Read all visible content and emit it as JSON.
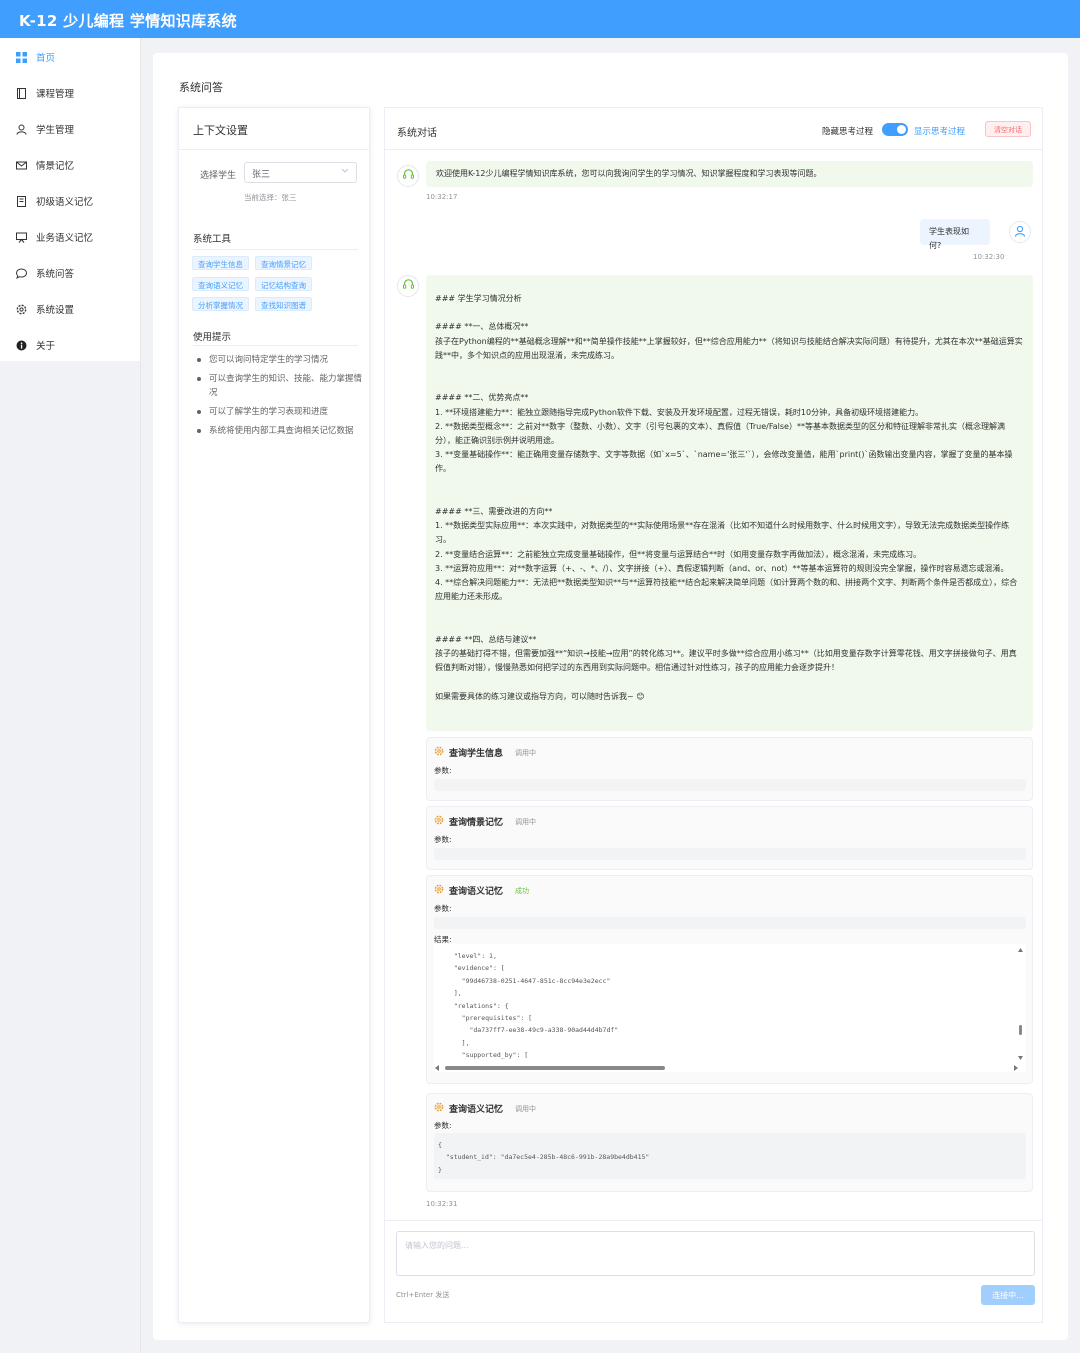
{
  "app": {
    "title": "K-12 少儿编程 学情知识库系统"
  },
  "sidebar": {
    "items": [
      {
        "label": "首页",
        "icon": "grid-icon",
        "active": true
      },
      {
        "label": "课程管理",
        "icon": "book-icon"
      },
      {
        "label": "学生管理",
        "icon": "user-icon"
      },
      {
        "label": "情景记忆",
        "icon": "mail-icon"
      },
      {
        "label": "初级语义记忆",
        "icon": "notebook-icon"
      },
      {
        "label": "业务语义记忆",
        "icon": "presentation-icon"
      },
      {
        "label": "系统问答",
        "icon": "chat-icon"
      },
      {
        "label": "系统设置",
        "icon": "gear-icon"
      },
      {
        "label": "关于",
        "icon": "info-icon"
      }
    ]
  },
  "page": {
    "title": "系统问答"
  },
  "context": {
    "title": "上下文设置",
    "select_label": "选择学生",
    "selected_student": "张三",
    "current_selection": "当前选择：张三",
    "tools_title": "系统工具",
    "tools": [
      "查询学生信息",
      "查询情景记忆",
      "查询语义记忆",
      "记忆结构查询",
      "分析掌握情况",
      "查找知识图谱"
    ],
    "tips_title": "使用提示",
    "tips": [
      "您可以询问特定学生的学习情况",
      "可以查询学生的知识、技能、能力掌握情况",
      "可以了解学生的学习表现和进度",
      "系统将使用内部工具查询相关记忆数据"
    ]
  },
  "chat": {
    "title": "系统对话",
    "hide_thinking": "隐藏思考过程",
    "show_thinking": "显示思考过程",
    "clear": "清空对话",
    "welcome": "欢迎使用K-12少儿编程学情知识库系统，您可以向我询问学生的学习情况、知识掌握程度和学习表现等问题。",
    "welcome_time": "10:32:17",
    "user_msg": "学生表现如何?",
    "user_time": "10:32:30",
    "answer": "### 学生学习情况分析\n\n#### **一、总体概况**\n孩子在Python编程的**基础概念理解**和**简单操作技能**上掌握较好，但**综合应用能力**（将知识与技能结合解决实际问题）有待提升，尤其在本次**基础运算实践**中，多个知识点的应用出现混淆，未完成练习。\n\n\n#### **二、优势亮点**\n1. **环境搭建能力**：能独立跟随指导完成Python软件下载、安装及开发环境配置，过程无错误，耗时10分钟，具备初级环境搭建能力。\n2. **数据类型概念**：之前对**数字（整数、小数）、文字（引号包裹的文本）、真假值（True/False）**等基本数据类型的区分和特征理解非常扎实（概念理解满分），能正确识别示例并说明用途。\n3. **变量基础操作**：能正确用变量存储数字、文字等数据（如`x=5`、`name='张三'`），会修改变量值，能用`print()`函数输出变量内容，掌握了变量的基本操作。\n\n\n#### **三、需要改进的方向**\n1. **数据类型实际应用**：本次实践中，对数据类型的**实际使用场景**存在混淆（比如不知道什么时候用数字、什么时候用文字），导致无法完成数据类型操作练习。\n2. **变量结合运算**：之前能独立完成变量基础操作，但**将变量与运算结合**时（如用变量存数字再做加法），概念混淆，未完成练习。\n3. **运算符应用**：对**数字运算（+、-、*、/）、文字拼接（+）、真假逻辑判断（and、or、not）**等基本运算符的规则没完全掌握，操作时容易遗忘或混淆。\n4. **综合解决问题能力**：无法把**数据类型知识**与**运算符技能**结合起来解决简单问题（如计算两个数的和、拼接两个文字、判断两个条件是否都成立），综合应用能力还未形成。\n\n\n#### **四、总结与建议**\n孩子的基础打得不错，但需要加强**“知识→技能→应用”的转化练习**。建议平时多做**综合应用小练习**（比如用变量存数字计算零花钱、用文字拼接做句子、用真假值判断对错），慢慢熟悉如何把学过的东西用到实际问题中。相信通过针对性练习，孩子的应用能力会逐步提升！\n\n如果需要具体的练习建议或指导方向，可以随时告诉我~ 😊",
    "params_label": "参数:",
    "result_label": "结果:",
    "tool_calls": [
      {
        "name": "查询学生信息",
        "status": "调用中"
      },
      {
        "name": "查询情景记忆",
        "status": "调用中"
      },
      {
        "name": "查询语义记忆",
        "status": "成功",
        "result": "  \"level\": 1,\n  \"evidence\": [\n    \"99d46738-0251-4647-851c-8cc94e3e2ecc\"\n  ],\n  \"relations\": {\n    \"prerequisites\": [\n      \"da737ff7-ee38-49c9-a338-90ad44d4b7df\"\n    ],\n    \"supported_by\": ["
      },
      {
        "name": "查询语义记忆",
        "status": "调用中",
        "params": "{\n  \"student_id\": \"da7ec5e4-285b-48c6-991b-28a9be4db415\"\n}"
      }
    ],
    "tools_time": "10:32:31",
    "input_placeholder": "请输入您的问题...",
    "hint": "Ctrl+Enter 发送",
    "send": "连接中..."
  },
  "colors": {
    "primary": "#409eff",
    "bot_bubble": "#f0f9eb",
    "user_bubble": "#ecf5ff",
    "danger": "#f56c6c",
    "tool_icon": "#e6a23c",
    "success": "#67c23a"
  }
}
